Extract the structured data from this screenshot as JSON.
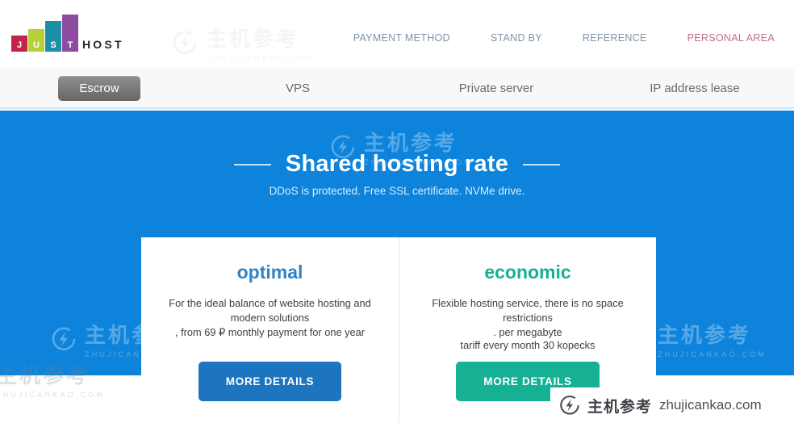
{
  "header": {
    "logo": {
      "bars": [
        {
          "letter": "J",
          "color": "#c4234b"
        },
        {
          "letter": "U",
          "color": "#b8cf3a"
        },
        {
          "letter": "S",
          "color": "#1b8fa8"
        },
        {
          "letter": "T",
          "color": "#8d4ba0"
        }
      ],
      "wordmark": "HOST"
    },
    "nav": [
      {
        "label": "PAYMENT METHOD",
        "accent": false
      },
      {
        "label": "STAND BY",
        "accent": false
      },
      {
        "label": "REFERENCE",
        "accent": false
      },
      {
        "label": "PERSONAL AREA",
        "accent": true
      }
    ]
  },
  "tabs": [
    {
      "label": "Escrow",
      "active": true
    },
    {
      "label": "VPS",
      "active": false
    },
    {
      "label": "Private server",
      "active": false
    },
    {
      "label": "IP address lease",
      "active": false
    }
  ],
  "hero": {
    "title": "Shared hosting rate",
    "subtitle": "DDoS is protected. Free SSL certificate. NVMe drive.",
    "background_color": "#0d83db"
  },
  "cards": [
    {
      "title": "optimal",
      "title_color": "#3282c4",
      "description": "For the ideal balance of website hosting and modern solutions",
      "price_bold": ", from 69 ₽",
      "price_rest": " monthly payment for one year",
      "button_label": "MORE DETAILS",
      "button_color": "#1d74bf"
    },
    {
      "title": "economic",
      "title_color": "#16b094",
      "description": "Flexible hosting service, there is no space restrictions",
      "price_line1": ". per megabyte",
      "price_bold_a": "tariff",
      "price_mid": " every month ",
      "price_bold_b": "30 kopecks",
      "button_label": "MORE DETAILS",
      "button_color": "#16b094"
    }
  ],
  "watermark": {
    "cn": "主机参考",
    "domain": "ZHUJICANKAO.COM",
    "icon": "lightning-circle-icon"
  },
  "banner": {
    "cn": "主机参考",
    "url": "zhujicankao.com",
    "icon": "lightning-circle-icon"
  }
}
